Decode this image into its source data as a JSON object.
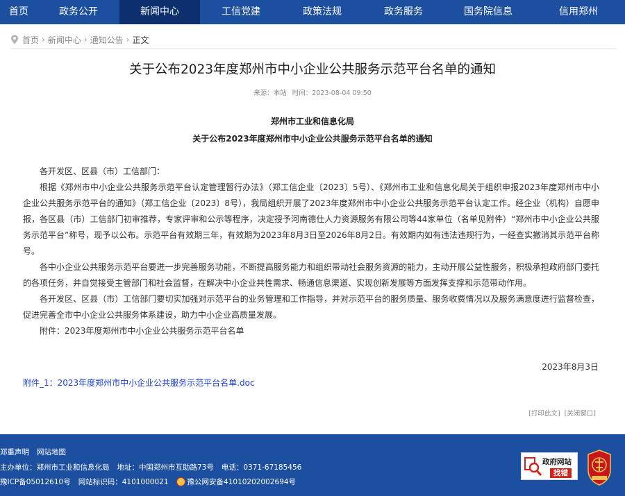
{
  "nav": {
    "items": [
      {
        "label": "首页"
      },
      {
        "label": "政务公开"
      },
      {
        "label": "新闻中心",
        "active": true
      },
      {
        "label": "工信党建"
      },
      {
        "label": "政策法规"
      },
      {
        "label": "政务服务"
      },
      {
        "label": "国务院信息"
      },
      {
        "label": "信用郑州"
      }
    ]
  },
  "breadcrumb": {
    "items": [
      "首页",
      "新闻中心",
      "通知公告",
      "正文"
    ],
    "separator": "›",
    "icon": "location-pin-icon"
  },
  "article": {
    "title": "关于公布2023年度郑州市中小企业公共服务示范平台名单的通知",
    "source": "来源：本站",
    "time": "时间：2023-08-04 09:50",
    "doc_org": "郑州市工业和信息化局",
    "doc_title": "关于公布2023年度郑州市中小企业公共服务示范平台名单的通知",
    "paragraphs": [
      "各开发区、区县（市）工信部门：",
      "根据《郑州市中小企业公共服务示范平台认定管理暂行办法》（郑工信企业〔2023〕5号）、《郑州市工业和信息化局关于组织申报2023年度郑州市中小企业公共服务示范平台的通知》（郑工信企业〔2023〕8号），我局组织开展了2023年度郑州市中小企业公共服务示范平台认定工作。经企业（机构）自愿申报，各区县（市）工信部门初审推荐，专家评审和公示等程序，决定授予河南德仕人力资源服务有限公司等44家单位（名单见附件）“郑州市中小企业公共服务示范平台”称号，现予以公布。示范平台有效期三年，有效期为2023年8月3日至2026年8月2日。有效期内如有违法违规行为，一经查实撤消其示范平台称号。",
      "各中小企业公共服务示范平台要进一步完善服务功能，不断提高服务能力和组织带动社会服务资源的能力，主动开展公益性服务，积极承担政府部门委托的各项任务，并自觉接受主管部门和社会监督，在解决中小企业共性需求、畅通信息渠道、实现创新发展等方面发挥支撑和示范带动作用。",
      "各开发区、区县（市）工信部门要切实加强对示范平台的业务管理和工作指导，并对示范平台的服务质量、服务收费情况以及服务满意度进行监督检查，促进完善全市中小企业公共服务体系建设，助力中小企业高质量发展。",
      "附件：2023年度郑州市中小企业公共服务示范平台名单"
    ],
    "sign_date": "2023年8月3日",
    "attachment_link": "附件_1：2023年度郑州市中小企业公共服务示范平台名单.doc",
    "print_label": "[打印此文]",
    "close_label": "[关闭窗口]"
  },
  "footer": {
    "disclaimer": "郑重声明",
    "sitemap": "网站地图",
    "sponsor": "主办单位：郑州市工业和信息化局",
    "address": "地址：中国郑州市互助路73号",
    "phone": "电话：0371-67185456",
    "icp": "豫ICP备05012610号",
    "site_code": "网站标识码：4101000021",
    "police_record": "豫公网安备41010202002694号",
    "jiucuo_line1": "政府网站",
    "jiucuo_line2": "找错",
    "colors": {
      "nav_bg": "#1c4fa0",
      "nav_active": "#0d2f6e",
      "link": "#1a3fd6",
      "badge_red": "#d4231a"
    }
  }
}
